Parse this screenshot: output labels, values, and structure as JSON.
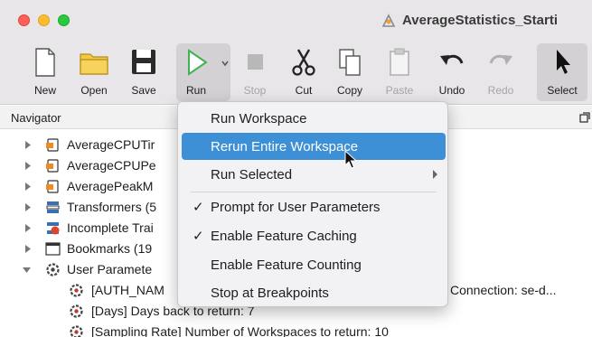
{
  "window": {
    "title": "AverageStatistics_Starti"
  },
  "toolbar": {
    "new": "New",
    "open": "Open",
    "save": "Save",
    "run": "Run",
    "stop": "Stop",
    "cut": "Cut",
    "copy": "Copy",
    "paste": "Paste",
    "undo": "Undo",
    "redo": "Redo",
    "select": "Select"
  },
  "navigator": {
    "title": "Navigator",
    "items": [
      {
        "label": "AverageCPUTir"
      },
      {
        "label": "AverageCPUPe"
      },
      {
        "label": "AveragePeakM"
      },
      {
        "label": "Transformers (5"
      },
      {
        "label": "Incomplete Trai"
      },
      {
        "label": "Bookmarks (19"
      },
      {
        "label": "User Paramete"
      },
      {
        "label": "[AUTH_NAM",
        "suffix": "Connection: se-d..."
      },
      {
        "label": "[Days] Days back to return: 7"
      },
      {
        "label": "[Sampling Rate] Number of Workspaces to return: 10"
      }
    ]
  },
  "run_menu": {
    "items": [
      {
        "label": "Run Workspace",
        "checked": false,
        "highlighted": false
      },
      {
        "label": "Rerun Entire Workspace",
        "checked": false,
        "highlighted": true
      },
      {
        "label": "Run Selected",
        "checked": false,
        "highlighted": false,
        "submenu": true
      },
      {
        "label": "Prompt for User Parameters",
        "checked": true,
        "highlighted": false
      },
      {
        "label": "Enable Feature Caching",
        "checked": true,
        "highlighted": false
      },
      {
        "label": "Enable Feature Counting",
        "checked": false,
        "highlighted": false
      },
      {
        "label": "Stop at Breakpoints",
        "checked": false,
        "highlighted": false
      }
    ],
    "check_glyph": "✓"
  },
  "colors": {
    "highlight": "#3d8fd6",
    "run_green": "#3fb34f",
    "folder_yellow": "#f5c842"
  }
}
